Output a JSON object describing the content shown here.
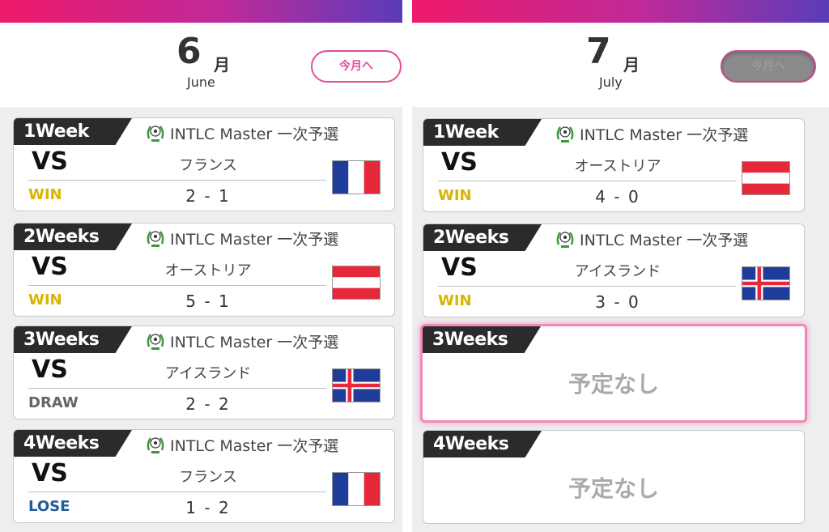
{
  "colors": {
    "accent": "#e74a9a",
    "win": "#d9b400",
    "draw": "#666666",
    "lose": "#1f5c98",
    "tab": "#2b2b2b"
  },
  "tournament_icon": "soccer-ball-laurel-icon",
  "panels": [
    {
      "month_num": "6",
      "month_kanji": "月",
      "month_en": "June",
      "today_button": "今月へ",
      "today_state": "active",
      "weeks": [
        {
          "label": "1Week",
          "tournament": "INTLC Master 一次予選",
          "vs": "VS",
          "opponent": "フランス",
          "result": "WIN",
          "result_type": "win",
          "score": "2 - 1",
          "flag": "france"
        },
        {
          "label": "2Weeks",
          "tournament": "INTLC Master 一次予選",
          "vs": "VS",
          "opponent": "オーストリア",
          "result": "WIN",
          "result_type": "win",
          "score": "5 - 1",
          "flag": "austria"
        },
        {
          "label": "3Weeks",
          "tournament": "INTLC Master 一次予選",
          "vs": "VS",
          "opponent": "アイスランド",
          "result": "DRAW",
          "result_type": "draw",
          "score": "2 - 2",
          "flag": "iceland"
        },
        {
          "label": "4Weeks",
          "tournament": "INTLC Master 一次予選",
          "vs": "VS",
          "opponent": "フランス",
          "result": "LOSE",
          "result_type": "lose",
          "score": "1 - 2",
          "flag": "france"
        }
      ]
    },
    {
      "month_num": "7",
      "month_kanji": "月",
      "month_en": "July",
      "today_button": "今月へ",
      "today_state": "disabled",
      "weeks": [
        {
          "label": "1Week",
          "tournament": "INTLC Master 一次予選",
          "vs": "VS",
          "opponent": "オーストリア",
          "result": "WIN",
          "result_type": "win",
          "score": "4 - 0",
          "flag": "austria"
        },
        {
          "label": "2Weeks",
          "tournament": "INTLC Master 一次予選",
          "vs": "VS",
          "opponent": "アイスランド",
          "result": "WIN",
          "result_type": "win",
          "score": "3 - 0",
          "flag": "iceland"
        },
        {
          "label": "3Weeks",
          "empty": "予定なし",
          "selected": true
        },
        {
          "label": "4Weeks",
          "empty": "予定なし"
        }
      ]
    }
  ]
}
